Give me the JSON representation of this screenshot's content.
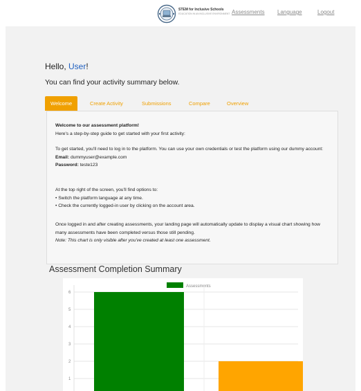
{
  "header": {
    "brand_title": "STEM for Inclusive Schools",
    "brand_subtitle": "EDUCATION IN AN INCLUSIVE ENVIRONMENT",
    "nav": [
      "Assessments",
      "Language",
      "Logout"
    ]
  },
  "greeting": {
    "hello": "Hello, ",
    "user": "User",
    "exclaim": "!"
  },
  "subtitle": "You can find your activity summary below.",
  "tabs": [
    "Welcome",
    "Create Activity",
    "Submissions",
    "Compare",
    "Overview"
  ],
  "welcome": {
    "heading": "Welcome to our assessment platform!",
    "intro": "Here's a step-by-step guide to get started with your first activity:",
    "login_text": "To get started, you'll need to log in to the platform. You can use your own credentials or test the platform using our dummy account:",
    "email_label": "Email:",
    "email_value": "dummyuser@example.com",
    "password_label": "Password:",
    "password_value": "teste123",
    "options_intro": "At the top right of the screen, you'll find options to:",
    "option_1": "• Switch the platform language at any time.",
    "option_2": "• Check the currently logged-in user by clicking on the account area.",
    "landing_text": "Once logged in and after creating assessments, your landing page will automatically update to display a visual chart showing how many assessments have been completed versus those still pending.",
    "note": "Note: This chart is only visible after you've created at least one assessment."
  },
  "chart_title": "Assessment Completion Summary",
  "colors": {
    "accent": "#f0a000",
    "completed": "#008000",
    "pending": "#ffa500",
    "link_user": "#1f5fbf"
  },
  "chart_data": {
    "type": "bar",
    "title": "Assessment Completion Summary",
    "legend": "Assessments",
    "legend_position": "top",
    "categories": [
      "",
      ""
    ],
    "values": [
      6,
      2
    ],
    "bar_colors": [
      "#008000",
      "#ffa500"
    ],
    "y_ticks": [
      1,
      2,
      3,
      4,
      5,
      6
    ],
    "ylim": [
      0,
      6
    ],
    "grid": true
  }
}
